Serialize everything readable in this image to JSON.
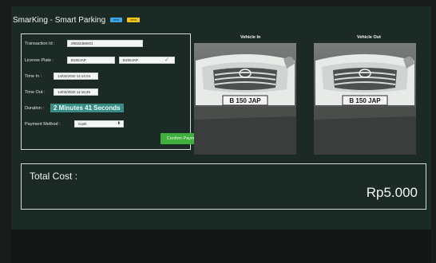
{
  "app": {
    "title": "SmarKing - Smart Parking",
    "badge_1": "new",
    "badge_2": "beta"
  },
  "form": {
    "transaction_id_label": "Transaction Id :",
    "transaction_id_value": "29022466001",
    "license_plate_label": "License Plate :",
    "license_plate_in": "B150JAP",
    "license_plate_out": "B150JAP",
    "time_in_label": "Time In :",
    "time_in_value": "14/02/2020 11:14:04",
    "time_out_label": "Time Out :",
    "time_out_value": "14/02/2020 11:16:45",
    "duration_label": "Duration :",
    "duration_value": "2 Minutes 41 Seconds",
    "payment_method_label": "Payment Method :",
    "payment_method_value": "Cash",
    "confirm_button": "Confirm Payment"
  },
  "vehicle_in": {
    "title": "Vehicle In",
    "plate": "B 150 JAP"
  },
  "vehicle_out": {
    "title": "Vehicle Out",
    "plate": "B 150 JAP"
  },
  "total": {
    "label": "Total Cost :",
    "value": "Rp5.000"
  }
}
